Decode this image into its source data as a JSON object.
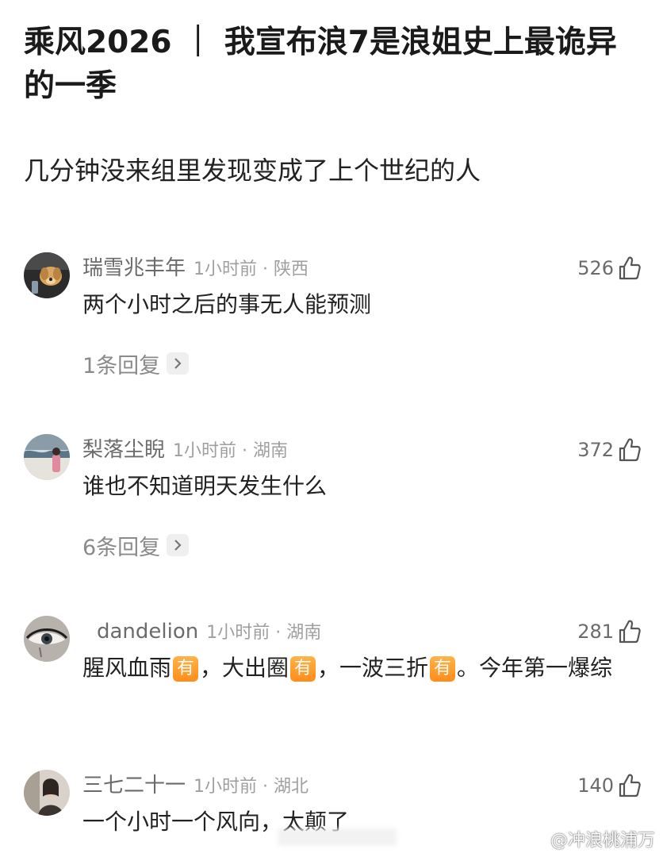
{
  "post": {
    "title": "乘风2026 ｜ 我宣布浪7是浪姐史上最诡异的一季",
    "subtitle": "几分钟没来组里发现变成了上个世纪的人"
  },
  "comments": [
    {
      "username": "瑞雪兆丰年",
      "time_loc": "1小时前 · 陕西",
      "likes": "526",
      "text": "两个小时之后的事无人能预测",
      "replies": "1条回复",
      "avatar_icon": "dog-avatar"
    },
    {
      "username": "梨落尘睨",
      "time_loc": "1小时前 · 湖南",
      "likes": "372",
      "text": "谁也不知道明天发生什么",
      "replies": "6条回复",
      "avatar_icon": "seaside-avatar"
    },
    {
      "username": "dandelion",
      "time_loc": "1小时前 · 湖南",
      "likes": "281",
      "text_parts": [
        "腥风血雨",
        "，大出圈",
        "，一波三折",
        "。今年第一爆综"
      ],
      "badge": "有",
      "avatar_icon": "eye-avatar"
    },
    {
      "username": "三七二十一",
      "time_loc": "1小时前 · 湖北",
      "likes": "140",
      "text": "一个小时一个风向，太颠了",
      "avatar_icon": "person-avatar"
    }
  ],
  "watermark": {
    "text": "@冲浪桃浦万",
    "icon": "weibo-logo-icon"
  },
  "colors": {
    "badge": "#ff9a2e",
    "meta": "#9f9f9f",
    "username": "#6b6b6b"
  }
}
